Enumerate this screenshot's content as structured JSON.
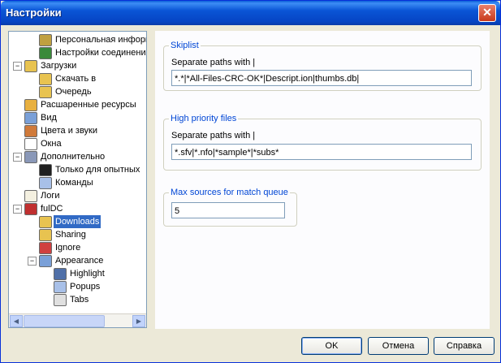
{
  "window": {
    "title": "Настройки",
    "close_glyph": "✕"
  },
  "tree": {
    "items": [
      {
        "label": "Персональная информац",
        "icon": "user-icon",
        "color": "#c0a040"
      },
      {
        "label": "Настройки соединения",
        "icon": "globe-icon",
        "color": "#3a8a3a"
      },
      {
        "label": "Загрузки",
        "icon": "folder-icon",
        "color": "#e8c350",
        "expander": "−"
      },
      {
        "label": "Скачать в",
        "icon": "folder-icon",
        "color": "#e8c350"
      },
      {
        "label": "Очередь",
        "icon": "folder-icon",
        "color": "#e8c350"
      },
      {
        "label": "Расшаренные ресурсы",
        "icon": "shared-folder-icon",
        "color": "#e8b040"
      },
      {
        "label": "Вид",
        "icon": "monitor-icon",
        "color": "#7aa0d8"
      },
      {
        "label": "Цвета и звуки",
        "icon": "palette-icon",
        "color": "#d07a3a"
      },
      {
        "label": "Окна",
        "icon": "window-icon",
        "color": "#ffffff"
      },
      {
        "label": "Дополнительно",
        "icon": "computer-icon",
        "color": "#8a98b8",
        "expander": "−"
      },
      {
        "label": "Только для опытных",
        "icon": "console-icon",
        "color": "#202020"
      },
      {
        "label": "Команды",
        "icon": "command-icon",
        "color": "#a8c0e8"
      },
      {
        "label": "Логи",
        "icon": "log-icon",
        "color": "#f4f0e0"
      },
      {
        "label": "fulDC",
        "icon": "app-icon",
        "color": "#c03030",
        "expander": "−"
      },
      {
        "label": "Downloads",
        "icon": "folder-icon",
        "color": "#e8c350"
      },
      {
        "label": "Sharing",
        "icon": "folder-icon",
        "color": "#e8c350"
      },
      {
        "label": "Ignore",
        "icon": "ignore-icon",
        "color": "#d04040"
      },
      {
        "label": "Appearance",
        "icon": "monitor-icon",
        "color": "#7aa0d8",
        "expander": "−"
      },
      {
        "label": "Highlight",
        "icon": "highlight-icon",
        "color": "#5070a8"
      },
      {
        "label": "Popups",
        "icon": "popup-icon",
        "color": "#a8c0e8"
      },
      {
        "label": "Tabs",
        "icon": "tabs-icon",
        "color": "#e0e0e0"
      }
    ],
    "selected": "Downloads",
    "scroll_left_glyph": "◀",
    "scroll_right_glyph": "▶"
  },
  "skiplist": {
    "title": "Skiplist",
    "hint": "Separate paths with |",
    "value": "*.*|*All-Files-CRC-OK*|Descript.ion|thumbs.db|"
  },
  "priority": {
    "title": "High priority files",
    "hint": "Separate paths with |",
    "value": "*.sfv|*.nfo|*sample*|*subs*"
  },
  "maxsources": {
    "title": "Max sources for match queue",
    "value": "5"
  },
  "buttons": {
    "ok": "OK",
    "cancel": "Отмена",
    "help": "Справка"
  },
  "colors": {
    "selection": "#316ac5",
    "legend": "#0046d5",
    "titlebar": "#0a55d6"
  }
}
